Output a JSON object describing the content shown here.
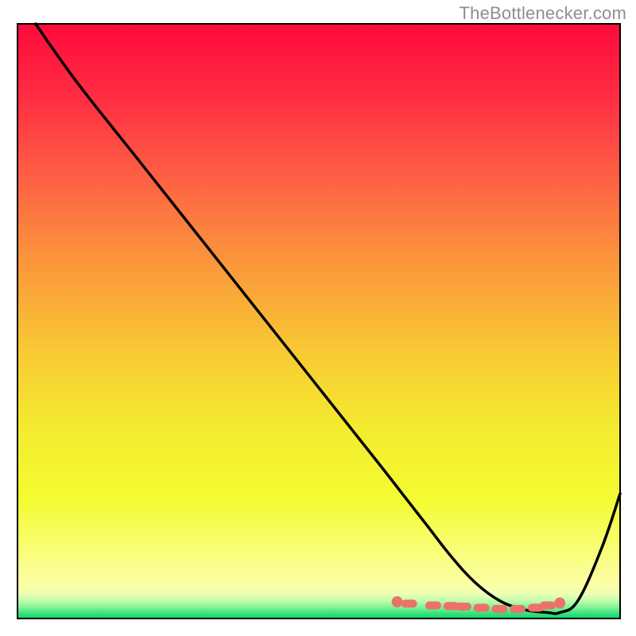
{
  "attribution": "TheBottlenecker.com",
  "accent_marker_color": "#EC7169",
  "curve_color": "#000000",
  "chart_data": {
    "type": "line",
    "title": "",
    "xlabel": "",
    "ylabel": "",
    "xlim": [
      0,
      100
    ],
    "ylim": [
      0,
      100
    ],
    "series": [
      {
        "name": "bottleneck-curve",
        "x": [
          3,
          10,
          20,
          30,
          40,
          50,
          60,
          64,
          68,
          72,
          76,
          80,
          84,
          88,
          90,
          93,
          97,
          100
        ],
        "values": [
          100,
          90,
          77.2,
          64.4,
          51.6,
          38.8,
          26.0,
          20.8,
          15.6,
          10.4,
          6.0,
          3.0,
          1.5,
          1.0,
          1.0,
          3.0,
          12.0,
          21.0
        ]
      }
    ],
    "markers": {
      "name": "optimum-band",
      "x": [
        63,
        65,
        69,
        72,
        74,
        77,
        80,
        83,
        86,
        88,
        90
      ],
      "values": [
        2.8,
        2.5,
        2.2,
        2.1,
        2.0,
        1.8,
        1.6,
        1.6,
        1.8,
        2.2,
        2.6
      ]
    },
    "gradient_stops": [
      {
        "offset": 0.0,
        "color": "#FF0A3B"
      },
      {
        "offset": 0.12,
        "color": "#FF2C43"
      },
      {
        "offset": 0.25,
        "color": "#FE5D44"
      },
      {
        "offset": 0.4,
        "color": "#FB963B"
      },
      {
        "offset": 0.55,
        "color": "#F8C934"
      },
      {
        "offset": 0.68,
        "color": "#F4EB2F"
      },
      {
        "offset": 0.8,
        "color": "#F4FC31"
      },
      {
        "offset": 0.945,
        "color": "#FCFFA8"
      },
      {
        "offset": 0.96,
        "color": "#E9FFB4"
      },
      {
        "offset": 0.972,
        "color": "#B8FCA8"
      },
      {
        "offset": 0.982,
        "color": "#7CF095"
      },
      {
        "offset": 0.992,
        "color": "#35E07E"
      },
      {
        "offset": 1.0,
        "color": "#06D66A"
      }
    ]
  }
}
